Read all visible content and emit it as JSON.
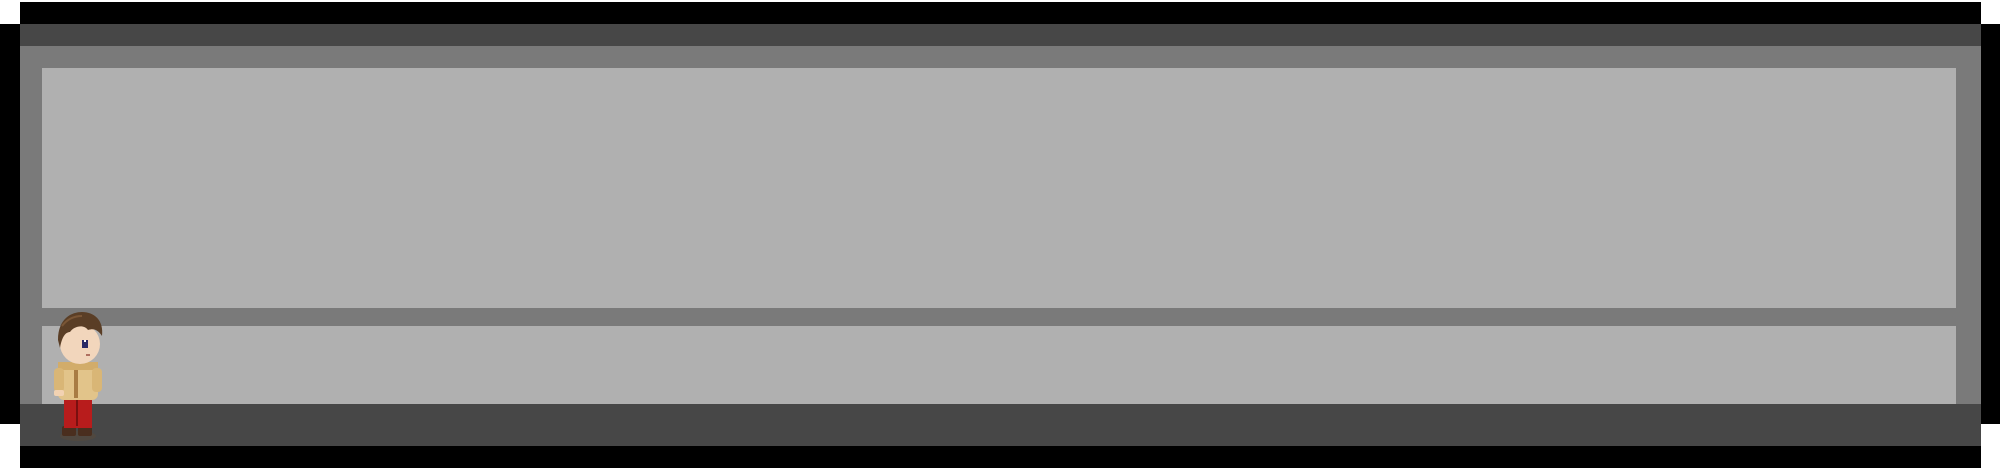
{
  "scene": {
    "colors": {
      "outline": "#000000",
      "wall_dark": "#474747",
      "wall_mid": "#7a7a7a",
      "floor": "#b0b0b0"
    },
    "player": {
      "icon": "player-character-sprite"
    }
  }
}
